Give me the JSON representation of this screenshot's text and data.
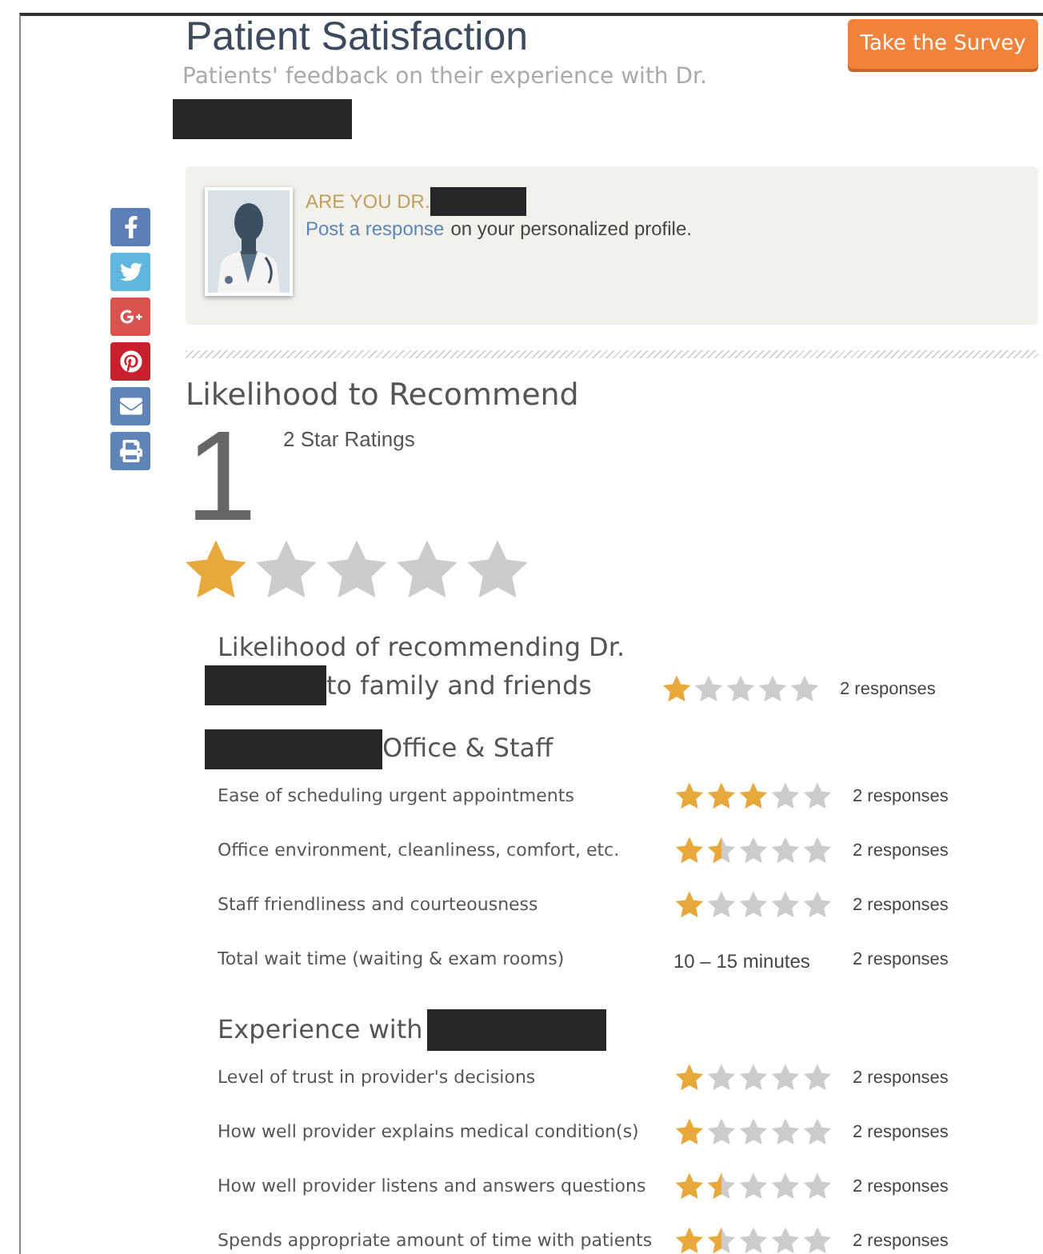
{
  "header": {
    "title": "Patient Satisfaction",
    "subtitle": "Patients' feedback on their experience with Dr.",
    "survey_button": "Take the Survey"
  },
  "share": [
    {
      "kind": "facebook",
      "color": "#5d7fb8"
    },
    {
      "kind": "twitter",
      "color": "#5fb6de"
    },
    {
      "kind": "googleplus",
      "color": "#d9534f"
    },
    {
      "kind": "pinterest",
      "color": "#c8202c"
    },
    {
      "kind": "email",
      "color": "#5f85b8"
    },
    {
      "kind": "print",
      "color": "#5f85b8"
    }
  ],
  "claim": {
    "question": "ARE YOU DR.",
    "link": "Post a response",
    "text": "on your personalized profile."
  },
  "recommend": {
    "title": "Likelihood to Recommend",
    "score": "1",
    "count": "2 Star Ratings",
    "stars": 1
  },
  "sections": [
    {
      "heading_lines": [
        "Likelihood of recommending Dr.",
        "to family and friends"
      ],
      "kind": "question",
      "rows": [
        {
          "kind": "stars",
          "stars": 1,
          "responses": "2 responses"
        }
      ]
    },
    {
      "heading_lines": [
        "Office & Staff"
      ],
      "kind": "redacted_before",
      "rows": [
        {
          "kind": "stars",
          "label": "Ease of scheduling urgent appointments",
          "stars": 3,
          "responses": "2 responses"
        },
        {
          "kind": "stars",
          "label": "Office environment, cleanliness, comfort, etc.",
          "stars": 1.5,
          "responses": "2 responses"
        },
        {
          "kind": "stars",
          "label": "Staff friendliness and courteousness",
          "stars": 1,
          "responses": "2 responses"
        },
        {
          "kind": "text",
          "label": "Total wait time (waiting & exam rooms)",
          "value": "10 – 15 minutes",
          "responses": "2 responses"
        }
      ]
    },
    {
      "heading_lines": [
        "Experience with"
      ],
      "kind": "redacted_after",
      "rows": [
        {
          "kind": "stars",
          "label": "Level of trust in provider's decisions",
          "stars": 1,
          "responses": "2 responses"
        },
        {
          "kind": "stars",
          "label": "How well provider explains medical condition(s)",
          "stars": 1,
          "responses": "2 responses"
        },
        {
          "kind": "stars",
          "label": "How well provider listens and answers questions",
          "stars": 1.5,
          "responses": "2 responses"
        },
        {
          "kind": "stars",
          "label": "Spends appropriate amount of time with patients",
          "stars": 1.5,
          "responses": "2 responses"
        }
      ]
    }
  ]
}
